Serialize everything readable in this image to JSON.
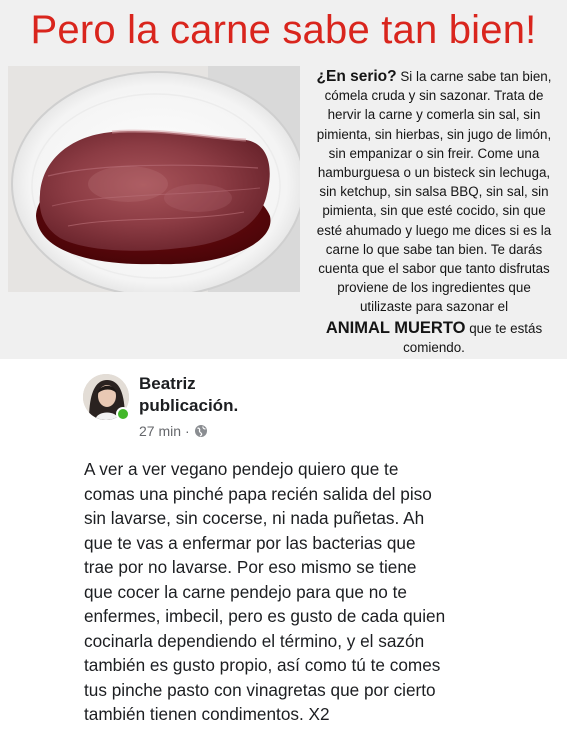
{
  "meme": {
    "title": "Pero la carne sabe tan bien!",
    "caption": {
      "lead": "¿En serio?",
      "line1_rest": " Si la carne sabe tan bien,",
      "lines_before_emphasis": [
        "cómela cruda y sin sazonar. Trata de",
        "hervir la carne y comerla sin sal, sin",
        "pimienta, sin hierbas, sin jugo de limón,",
        "sin empanizar o sin freir. Come una",
        "hamburguesa o un bisteck sin lechuga,",
        "sin ketchup, sin salsa BBQ, sin sal, sin",
        "pimienta, sin que esté cocido, sin que",
        "esté ahumado y luego me dices si es la",
        "carne lo que sabe tan bien. Te darás",
        "cuenta que el sabor que tanto disfrutas",
        "proviene de los ingredientes que",
        "utilizaste para sazonar el"
      ],
      "emphasis": "ANIMAL MUERTO",
      "emphasis_rest": " que te estás",
      "last_line": "comiendo."
    }
  },
  "post": {
    "author_line1": "Beatriz",
    "author_line2": "publicación.",
    "time": "27 min",
    "separator": "·",
    "privacy_icon": "globe-icon",
    "online_color": "#42b72a",
    "body_lines": [
      "A ver a ver vegano pendejo quiero que te",
      "comas una pinché papa recién salida del piso",
      "sin lavarse, sin cocerse, ni nada puñetas. Ah",
      "que te vas a enfermar por las bacterias que",
      "trae por no lavarse. Por eso mismo se tiene",
      "que cocer la carne pendejo para que no te",
      "enfermes, imbecil, pero es gusto de cada quien",
      "cocinarla dependiendo el término, y el sazón",
      "también es gusto propio, así como tú te comes",
      "tus pinche pasto con vinagretas que por cierto",
      "también tienen condimentos. X2"
    ]
  },
  "colors": {
    "title_red": "#d9251d",
    "panel_bg": "#f0f0f0",
    "meta_gray": "#65676b"
  }
}
